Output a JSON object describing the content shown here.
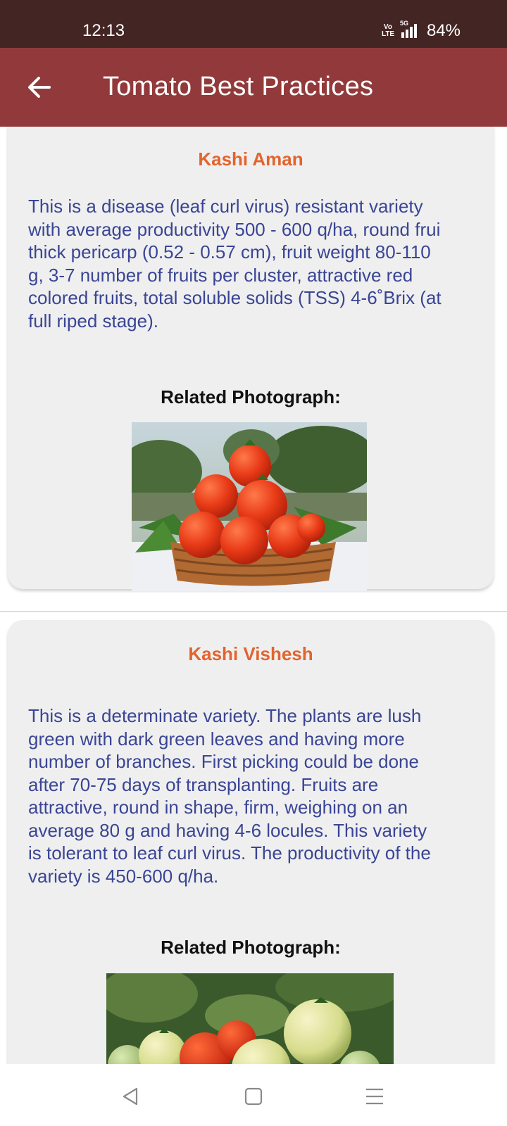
{
  "status_bar": {
    "time": "12:13",
    "network_top": "Vo",
    "network_bottom": "LTE",
    "signal_label": "5G",
    "battery": "84%"
  },
  "app_bar": {
    "title": "Tomato Best Practices",
    "back_icon": "arrow-left-icon"
  },
  "cards": [
    {
      "title": "Kashi Aman",
      "description_lines": [
        "This is a disease (leaf curl virus) resistant variety",
        "with average productivity 500 - 600 q/ha, round frui",
        "thick pericarp (0.52 - 0.57 cm), fruit weight 80-110",
        "g, 3-7 number of fruits per cluster, attractive red",
        "colored fruits, total soluble solids (TSS) 4-6˚Brix (at",
        "full riped stage)."
      ],
      "photo_label": "Related Photograph:",
      "photo_icon": "tomato-basket-photo"
    },
    {
      "title": "Kashi Vishesh",
      "description_lines": [
        "This is a determinate variety. The plants are lush",
        "green with dark green leaves and having more",
        "number of branches. First picking could be done",
        "after 70-75 days of transplanting. Fruits are",
        "attractive, round in shape, firm, weighing on an",
        "average 80 g and having 4-6 locules. This variety",
        "is tolerant to leaf curl virus. The productivity of the",
        "variety is 450-600 q/ha."
      ],
      "photo_label": "Related Photograph:",
      "photo_icon": "tomatoes-on-plant-photo"
    }
  ],
  "nav_bar": {
    "back_icon": "triangle-back-icon",
    "home_icon": "square-home-icon",
    "menu_icon": "menu-lines-icon"
  },
  "colors": {
    "status_bar": "#432523",
    "app_bar": "#923a3b",
    "variety_title": "#e2642e",
    "description_text": "#3a4595",
    "card_bg": "#efefef"
  }
}
